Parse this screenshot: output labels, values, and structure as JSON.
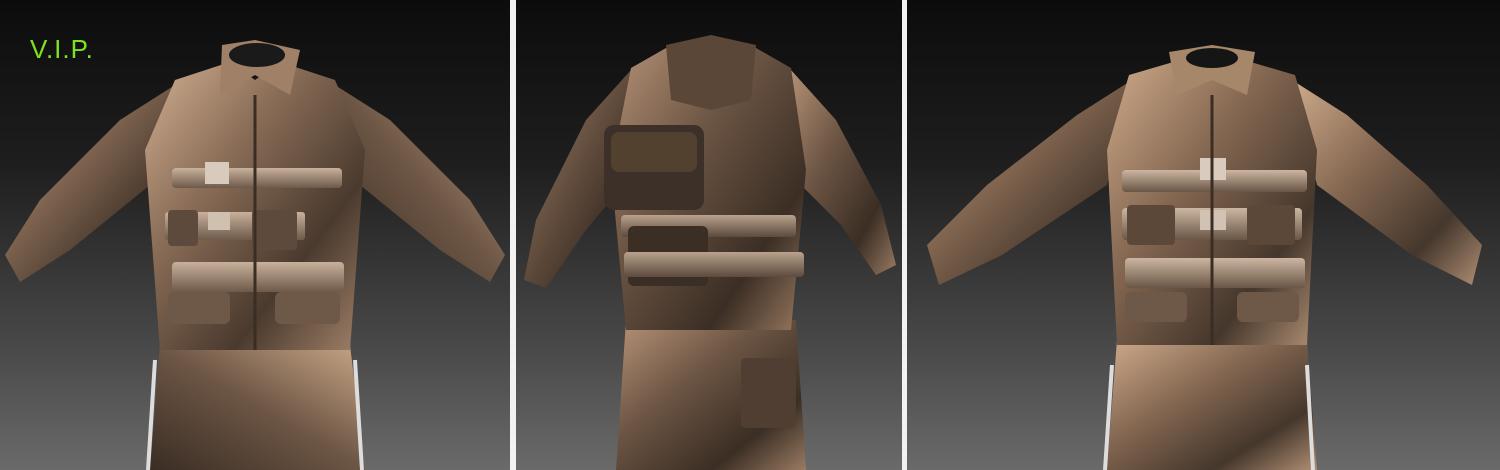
{
  "overlay": {
    "label": "V.I.P.",
    "label_color": "#7ee31f"
  },
  "views": [
    {
      "name": "front-view"
    },
    {
      "name": "back-view"
    },
    {
      "name": "front-view-2"
    }
  ],
  "colors": {
    "jacket": "#7a6250",
    "highlight": "#c7a588",
    "shadow": "#2f241d",
    "belt": "#b7a08c"
  }
}
